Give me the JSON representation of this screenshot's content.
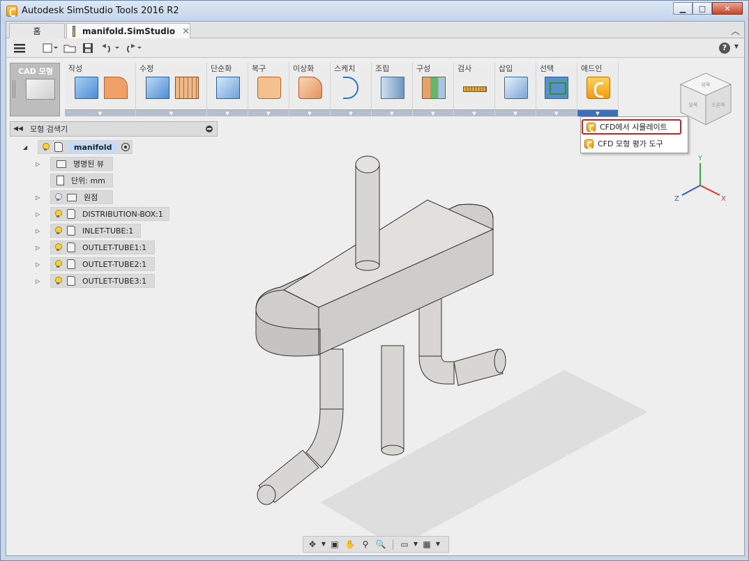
{
  "window": {
    "title": "Autodesk SimStudio Tools 2016 R2",
    "minimize": "▁",
    "maximize": "□",
    "close": "✕"
  },
  "tabs": {
    "home": "홈",
    "document": "manifold.SimStudio",
    "close_glyph": "✕",
    "collapse_glyph": "︿"
  },
  "qat": {
    "menu_icon": "hamburger-menu-icon",
    "help": "?"
  },
  "ribbon": {
    "workspace_label": "CAD 모형",
    "groups": [
      {
        "label": "작성",
        "icon": "create-icon"
      },
      {
        "label": "수정",
        "icon": "modify-icon"
      },
      {
        "label": "단순화",
        "icon": "simplify-icon"
      },
      {
        "label": "복구",
        "icon": "restore-icon"
      },
      {
        "label": "이상화",
        "icon": "idealize-icon"
      },
      {
        "label": "스케치",
        "icon": "sketch-icon"
      },
      {
        "label": "조립",
        "icon": "assemble-icon"
      },
      {
        "label": "구성",
        "icon": "configure-icon"
      },
      {
        "label": "검사",
        "icon": "inspect-icon"
      },
      {
        "label": "삽입",
        "icon": "insert-icon"
      },
      {
        "label": "선택",
        "icon": "select-icon"
      },
      {
        "label": "애드인",
        "icon": "addin-icon"
      }
    ],
    "drop_glyph": "▼"
  },
  "dropdown": {
    "items": [
      {
        "label": "CFD에서 시뮬레이트",
        "highlighted": true
      },
      {
        "label": "CFD 모형 평가 도구",
        "highlighted": false
      }
    ]
  },
  "browser": {
    "title": "모형 검색기",
    "collapse_glyph": "◀◀",
    "root": "manifold",
    "items": [
      {
        "label": "명명된 뷰",
        "kind": "folder"
      },
      {
        "label": "단위: mm",
        "kind": "units"
      },
      {
        "label": "원점",
        "kind": "folder-bulb"
      },
      {
        "label": "DISTRIBUTION-BOX:1",
        "kind": "component"
      },
      {
        "label": "INLET-TUBE:1",
        "kind": "component"
      },
      {
        "label": "OUTLET-TUBE1:1",
        "kind": "component"
      },
      {
        "label": "OUTLET-TUBE2:1",
        "kind": "component"
      },
      {
        "label": "OUTLET-TUBE3:1",
        "kind": "component"
      }
    ],
    "expand_glyph": "▷",
    "expanded_glyph": "◢"
  },
  "viewcube": {
    "faces": [
      "앞쪽",
      "위쪽",
      "오른쪽"
    ]
  },
  "triad": {
    "x": "X",
    "y": "Y",
    "z": "Z"
  },
  "colors": {
    "accent_blue": "#3f6fb5",
    "highlight_red": "#d21f1f",
    "model_fill": "#d8d6d2",
    "x_axis": "#e0342c",
    "y_axis": "#2fae3a",
    "z_axis": "#3459c9"
  }
}
